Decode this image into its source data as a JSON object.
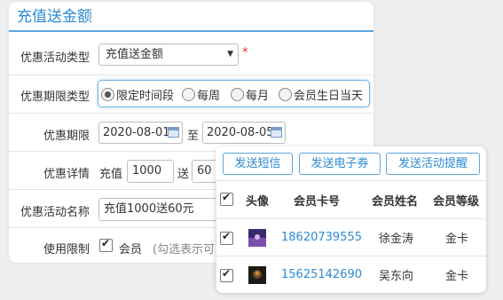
{
  "form": {
    "title": "充值送金额",
    "activity_type": {
      "label": "优惠活动类型",
      "value": "充值送金额",
      "required_mark": "*"
    },
    "period_type": {
      "label": "优惠期限类型",
      "options": [
        "限定时间段",
        "每周",
        "每月",
        "会员生日当天"
      ],
      "selected": "限定时间段"
    },
    "period": {
      "label": "优惠期限",
      "start": "2020-08-01",
      "separator": "至",
      "end": "2020-08-05"
    },
    "details": {
      "label": "优惠详情",
      "recharge_label": "充值",
      "recharge_value": "1000",
      "give_label": "送",
      "give_value": "60"
    },
    "name": {
      "label": "优惠活动名称",
      "value": "充值1000送60元"
    },
    "limit": {
      "label": "使用限制",
      "member_label": "会员",
      "hint": "(勾选表示可"
    }
  },
  "popup": {
    "buttons": [
      "发送短信",
      "发送电子券",
      "发送活动提醒"
    ],
    "columns": [
      "头像",
      "会员卡号",
      "会员姓名",
      "会员等级"
    ],
    "rows": [
      {
        "avatar": "avatar-purple-icon",
        "card_no": "18620739555",
        "name": "徐金涛",
        "level": "金卡"
      },
      {
        "avatar": "avatar-dark-icon",
        "card_no": "15625142690",
        "name": "吴东向",
        "level": "金卡"
      }
    ]
  },
  "colors": {
    "accent": "#2b8ad6",
    "border_blue": "#5aa5e0",
    "required": "#e03030"
  }
}
